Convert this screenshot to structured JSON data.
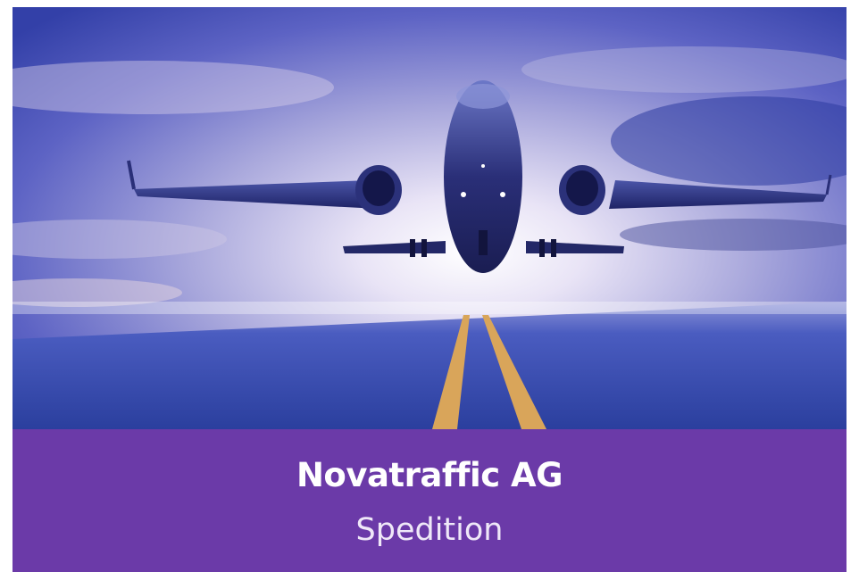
{
  "card": {
    "company_name": "Novatraffic AG",
    "category": "Spedition"
  },
  "image": {
    "icon": "airplane-takeoff-photo"
  },
  "colors": {
    "caption_background": "#6b3aa8",
    "caption_text": "#ffffff",
    "sky_top": "#3a4fb8",
    "runway": "#3548a8",
    "runway_stripe": "#d9a55a"
  }
}
